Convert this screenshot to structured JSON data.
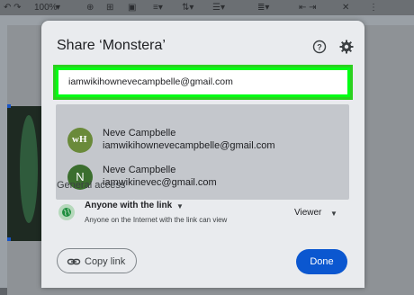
{
  "toolbar": {
    "zoom": "100%"
  },
  "dialog": {
    "title": "Share ‘Monstera’",
    "email_value": "iamwikihownevecampbelle@gmail.com",
    "suggestions": [
      {
        "name": "Neve Campbelle",
        "email": "iamwikihownevecampbelle@gmail.com",
        "avatar": "wikihow-logo"
      },
      {
        "name": "Neve Campbelle",
        "email": "iamwikinevec@gmail.com",
        "avatar_letter": "N"
      }
    ],
    "general_access": {
      "label": "General access",
      "selected": "Anyone with the link",
      "description": "Anyone on the Internet with the link can view",
      "role": "Viewer"
    },
    "copy_link_label": "Copy link",
    "done_label": "Done"
  },
  "colors": {
    "highlight": "#00ff14",
    "done_button": "#0b57d0",
    "dialog_bg": "#e9ebee"
  },
  "icons": [
    "help-icon",
    "settings-gear-icon",
    "globe-icon",
    "link-icon",
    "dropdown-caret-icon"
  ]
}
